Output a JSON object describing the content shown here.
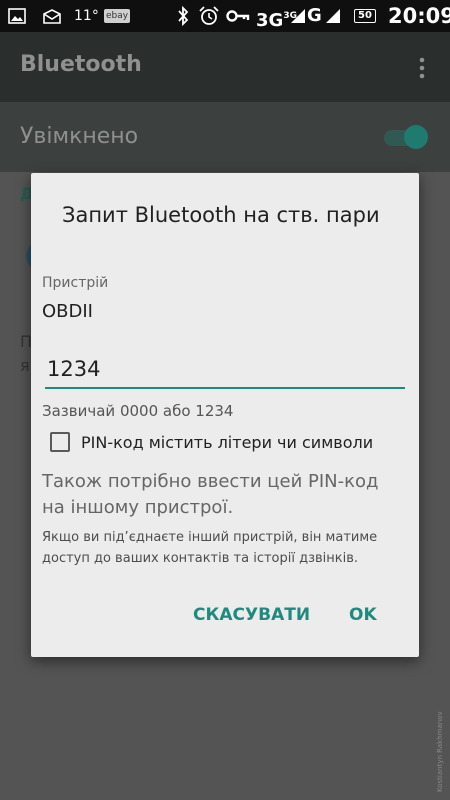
{
  "status_bar": {
    "temperature": "11°",
    "ebay_label": "ebay",
    "network_3g": "3G",
    "network_3g_sup": "3G",
    "network_g": "G",
    "battery": "50",
    "time": "20:09"
  },
  "app_bar": {
    "title": "Bluetooth"
  },
  "toggle_row": {
    "label": "Увімкнено"
  },
  "background": {
    "frag_1": "Д",
    "frag_2": "П",
    "frag_3": "я"
  },
  "dialog": {
    "title": "Запит Bluetooth на ств. пари",
    "device_label": "Пристрій",
    "device_name": "OBDII",
    "pin_value": "1234",
    "pin_hint": "Зазвичай 0000 або 1234",
    "checkbox_label": "PIN-код містить літери чи символи",
    "info_main": "Також потрібно ввести цей PIN-код на іншому пристрої.",
    "info_sub": "Якщо ви під’єднаєте інший пристрій, він матиме доступ до ваших контактів та історії дзвінків.",
    "cancel_label": "СКАСУВАТИ",
    "ok_label": "OK"
  },
  "watermark": "Kostiantyn Rakhmanov",
  "colors": {
    "accent": "#1e8b7e",
    "dialog_bg": "#ececec",
    "scrim": "#545454"
  }
}
